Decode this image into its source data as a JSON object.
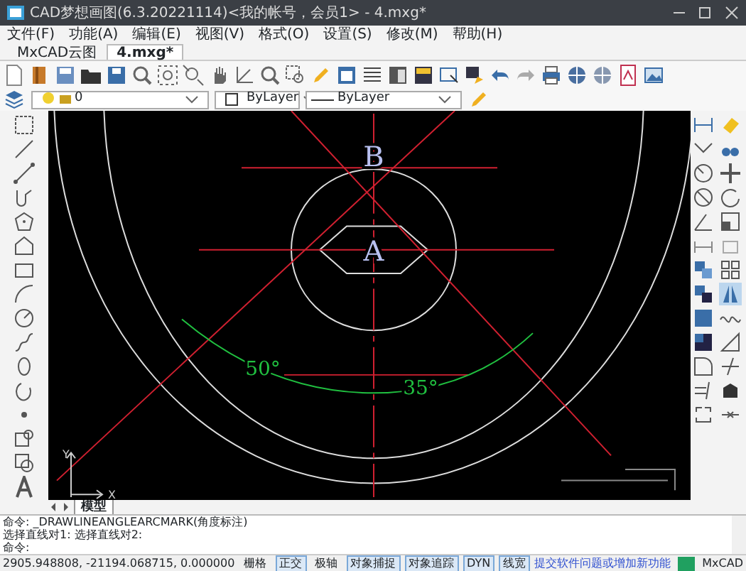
{
  "window": {
    "title": "CAD梦想画图(6.3.20221114)<我的帐号，会员1> - 4.mxg*"
  },
  "menu": [
    "文件(F)",
    "功能(A)",
    "编辑(E)",
    "视图(V)",
    "格式(O)",
    "设置(S)",
    "修改(M)",
    "帮助(H)"
  ],
  "doc_tabs": [
    {
      "label": "MxCAD云图",
      "selected": false
    },
    {
      "label": "4.mxg*",
      "selected": true
    }
  ],
  "layer_bar": {
    "layer": "0",
    "color_setting": "ByLayer",
    "linetype": "ByLayer"
  },
  "drawing": {
    "labels": [
      {
        "kind": "point",
        "text": "B"
      },
      {
        "kind": "point",
        "text": "A"
      },
      {
        "kind": "angle",
        "text": "50°"
      },
      {
        "kind": "angle",
        "text": "35°"
      }
    ],
    "axes": [
      "Y",
      "X"
    ]
  },
  "layout_tabs": [
    {
      "label": "模型",
      "selected": true
    }
  ],
  "command_lines": [
    "命令: _DRAWLINEANGLEARCMARK(角度标注)",
    "选择直线对1:  选择直线对2:",
    "命令:"
  ],
  "status_bar": {
    "coords": "2905.948808, -21194.068715, 0.000000",
    "toggles": [
      {
        "label": "栅格",
        "on": false
      },
      {
        "label": "正交",
        "on": true
      },
      {
        "label": "极轴",
        "on": false
      },
      {
        "label": "对象捕捉",
        "on": true
      },
      {
        "label": "对象追踪",
        "on": true
      },
      {
        "label": "DYN",
        "on": true
      },
      {
        "label": "线宽",
        "on": true
      }
    ],
    "link": "提交软件问题或增加新功能",
    "brand": "MxCAD"
  }
}
